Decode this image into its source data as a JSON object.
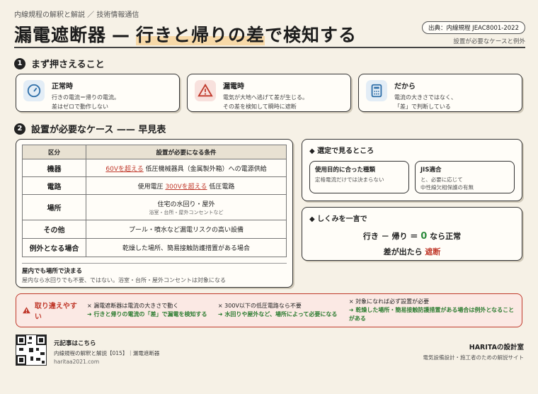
{
  "header": {
    "series": "内線規程の解釈と解説 ／ 技術情報通信",
    "title_main": "漏電遮断器",
    "title_dash": "—",
    "title_highlight": "行きと帰りの差",
    "title_tail": "で検知する",
    "source": "出典：内線規程 JEAC8001-2022",
    "source_note": "設置が必要なケースと例外"
  },
  "section1": {
    "num": "1",
    "title": "まず押さえること",
    "points": [
      {
        "title": "正常時",
        "lines": [
          "行きの電流＝帰りの電流。",
          "差はゼロで動作しない"
        ],
        "icon": "gauge-icon",
        "color": "#2f6fa8"
      },
      {
        "title": "漏電時",
        "lines": [
          "電気が大地へ逃げて差が生じる。",
          "その差を検知して瞬時に遮断"
        ],
        "icon": "warning-icon",
        "color": "#c0392b"
      },
      {
        "title": "だから",
        "lines": [
          "電流の大きさではなく、",
          "「差」で判断している"
        ],
        "icon": "calculator-icon",
        "color": "#2f6fa8"
      }
    ]
  },
  "section2": {
    "num": "2",
    "title": "設置が必要なケース —— 早見表",
    "table": {
      "headers": [
        "区分",
        "設置が必要になる条件"
      ],
      "rows": [
        {
          "cat": "機器",
          "pre": "",
          "red": "60Vを超える",
          "post": "低圧機械器具（金属製外箱）への電源供給",
          "sub": ""
        },
        {
          "cat": "電路",
          "pre": "使用電圧",
          "red": "300Vを超える",
          "post": "低圧電路",
          "sub": ""
        },
        {
          "cat": "場所",
          "pre": "住宅の水回り・屋外",
          "red": "",
          "post": "",
          "sub": "浴室・台所・屋外コンセントなど"
        },
        {
          "cat": "その他",
          "pre": "プール・噴水など漏電リスクの高い設備",
          "red": "",
          "post": "",
          "sub": ""
        },
        {
          "cat": "例外となる場合",
          "pre": "乾燥した場所、簡易接触防護措置がある場合",
          "red": "",
          "post": "",
          "sub": ""
        }
      ]
    },
    "note_title": "屋内でも場所で決まる",
    "note_text": "屋内なら水回りでも不要、ではない。浴室・台所・屋外コンセントは対象になる"
  },
  "selection": {
    "title": "◆ 選定で見るところ",
    "items": [
      {
        "title": "使用目的に合った種類",
        "text": "定格電流だけでは決まらない"
      },
      {
        "title": "JIS適合",
        "text": "と、必要に応じて\n中性線欠相保護の有無"
      }
    ]
  },
  "mechanism": {
    "title": "◆ しくみを一言で",
    "line1_pre": "行き － 帰り ＝",
    "line1_zero": "0",
    "line1_post": "なら正常",
    "line2_pre": "差が出たら",
    "line2_red": "遮断"
  },
  "mistakes": {
    "label": "取り違えやすい",
    "cols": [
      {
        "wrong": "× 漏電遮断器は電流の大きさで動く",
        "right": "➜ 行きと帰りの電流の「差」で漏電を検知する"
      },
      {
        "wrong": "× 300V以下の低圧電路なら不要",
        "right": "➜ 水回りや屋外など、場所によって必要になる"
      },
      {
        "wrong": "× 対象になれば必ず設置が必要",
        "right": "➜ 乾燥した場所・簡易接触防護措置がある場合は例外となることがある"
      }
    ]
  },
  "footer": {
    "qr_title": "元記事はこちら",
    "qr_line": "内線規程の解釈と解説【015】｜漏電遮断器",
    "url": "haritaa2021.com",
    "brand": "HARITAの設計室",
    "tagline": "電気設備設計・施工者のための解説サイト"
  },
  "colors": {
    "accent_red": "#c0392b",
    "accent_green": "#2e8b3e",
    "highlight": "#f7d9a8"
  }
}
